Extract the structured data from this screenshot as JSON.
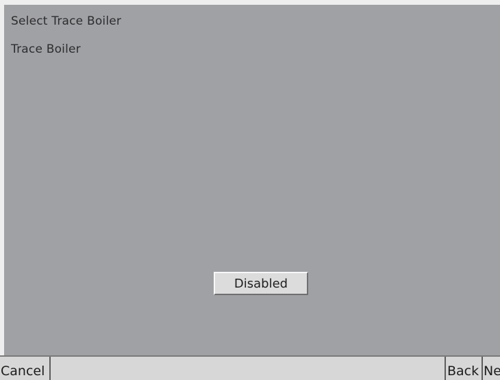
{
  "screen": {
    "title": "Select Trace Boiler",
    "field_label": "Trace Boiler"
  },
  "toggle": {
    "label": "Disabled"
  },
  "nav": {
    "cancel_label": "Cancel",
    "back_label": "Back",
    "next_label": "Ne"
  },
  "colors": {
    "panel_bg": "#a0a1a4",
    "bar_bg": "#d7d7d7",
    "text": "#2d2d2f"
  }
}
